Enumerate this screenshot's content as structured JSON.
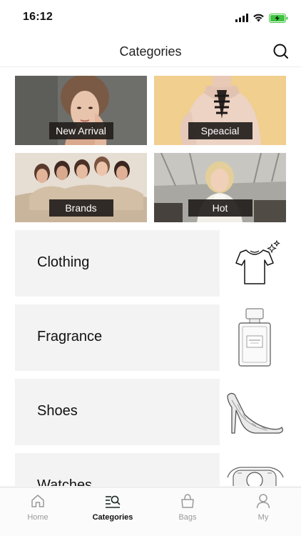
{
  "status": {
    "time": "16:12"
  },
  "header": {
    "title": "Categories"
  },
  "tiles": [
    {
      "label": "New Arrival"
    },
    {
      "label": "Speacial"
    },
    {
      "label": "Brands"
    },
    {
      "label": "Hot"
    }
  ],
  "categories": [
    {
      "label": "Clothing",
      "icon": "tshirt-icon"
    },
    {
      "label": "Fragrance",
      "icon": "perfume-bottle-icon"
    },
    {
      "label": "Shoes",
      "icon": "high-heel-icon"
    },
    {
      "label": "Watches",
      "icon": "watch-icon"
    }
  ],
  "tabbar": {
    "items": [
      {
        "label": "Home",
        "icon": "home-icon"
      },
      {
        "label": "Categories",
        "icon": "categories-search-icon",
        "active": true
      },
      {
        "label": "Bags",
        "icon": "bag-icon"
      },
      {
        "label": "My",
        "icon": "profile-icon"
      }
    ]
  },
  "colors": {
    "accent": "#1c2b24",
    "tile_label_bg": "#231e1c",
    "category_bg": "#f3f3f3",
    "battery": "#3ec33e"
  }
}
